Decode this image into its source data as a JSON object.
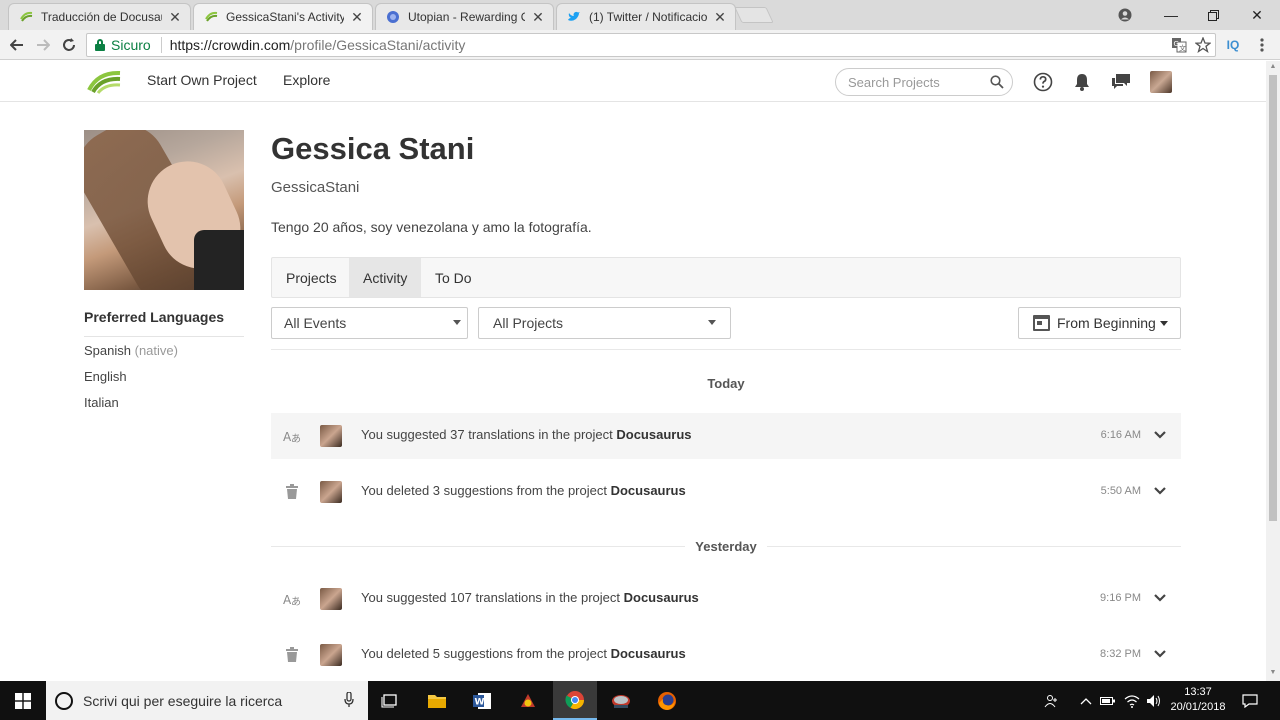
{
  "browser": {
    "tabs": [
      {
        "title": "Traducción de Docusaur",
        "active": false
      },
      {
        "title": "GessicaStani's Activity - C",
        "active": true
      },
      {
        "title": "Utopian - Rewarding Op",
        "active": false
      },
      {
        "title": "(1) Twitter / Notificacion",
        "active": false
      }
    ],
    "secure_label": "Sicuro",
    "url_host": "https://crowdin.com",
    "url_path": "/profile/GessicaStani/activity",
    "extension_label": "IQ"
  },
  "header": {
    "nav": [
      "Start Own Project",
      "Explore"
    ],
    "search_placeholder": "Search Projects"
  },
  "profile": {
    "name": "Gessica Stani",
    "username": "GessicaStani",
    "bio": "Tengo 20 años, soy venezolana y amo la fotografía.",
    "preferred_languages_title": "Preferred Languages",
    "languages": [
      {
        "name": "Spanish",
        "note": "(native)"
      },
      {
        "name": "English",
        "note": ""
      },
      {
        "name": "Italian",
        "note": ""
      }
    ]
  },
  "tabs": [
    {
      "label": "Projects",
      "active": false
    },
    {
      "label": "Activity",
      "active": true
    },
    {
      "label": "To Do",
      "active": false
    }
  ],
  "filters": {
    "events": "All Events",
    "projects": "All Projects",
    "date": "From Beginning"
  },
  "activity": {
    "groups": [
      {
        "day": "Today",
        "events": [
          {
            "type": "translate-icon",
            "prefix": "You suggested 37 translations in the project",
            "project": "Docusaurus",
            "time": "6:16 AM"
          },
          {
            "type": "trash-icon",
            "prefix": "You deleted 3 suggestions from the project",
            "project": "Docusaurus",
            "time": "5:50 AM"
          }
        ]
      },
      {
        "day": "Yesterday",
        "events": [
          {
            "type": "translate-icon",
            "prefix": "You suggested 107 translations in the project",
            "project": "Docusaurus",
            "time": "9:16 PM"
          },
          {
            "type": "trash-icon",
            "prefix": "You deleted 5 suggestions from the project",
            "project": "Docusaurus",
            "time": "8:32 PM"
          }
        ]
      }
    ]
  },
  "taskbar": {
    "search_placeholder": "Scrivi qui per eseguire la ricerca",
    "time": "13:37",
    "date": "20/01/2018"
  },
  "colors": {
    "secure_green": "#0b8043",
    "crowdin_green": "#8cc63f",
    "taskbar": "#101010"
  }
}
